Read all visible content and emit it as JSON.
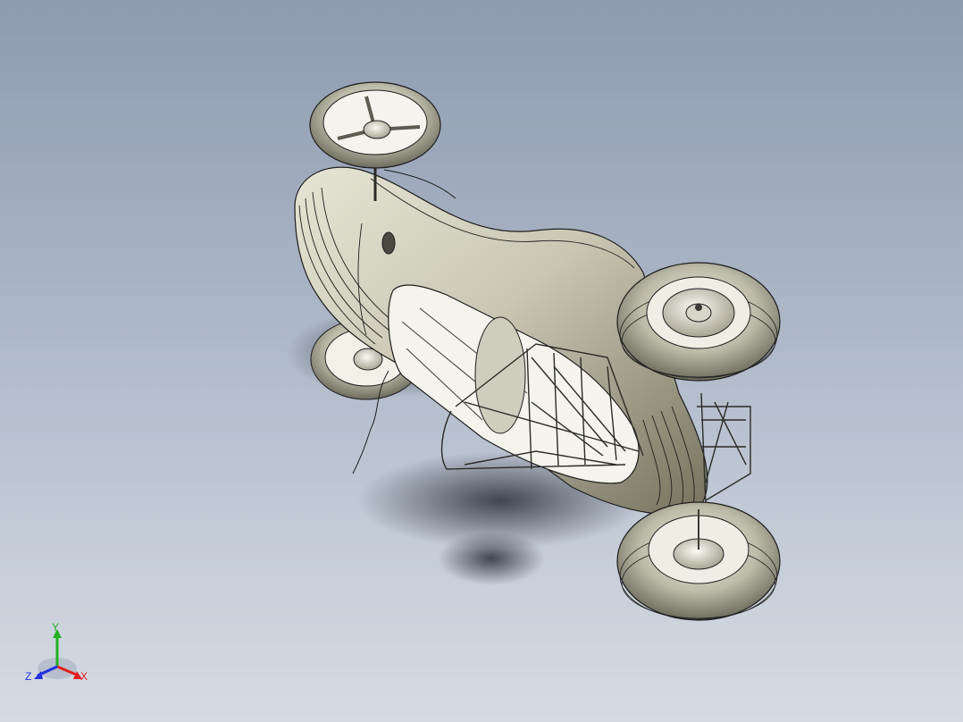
{
  "triad": {
    "x_label": "X",
    "y_label": "Y",
    "z_label": "Z",
    "x_color": "#e02020",
    "y_color": "#22b022",
    "z_color": "#2030e0"
  },
  "colors": {
    "background_top": "#8e9bb0",
    "background_bottom": "#d6dbe3",
    "model_body": "#c9c7b4",
    "model_shade": "#6f6d60",
    "edge_lines": "#1e1e1e"
  }
}
